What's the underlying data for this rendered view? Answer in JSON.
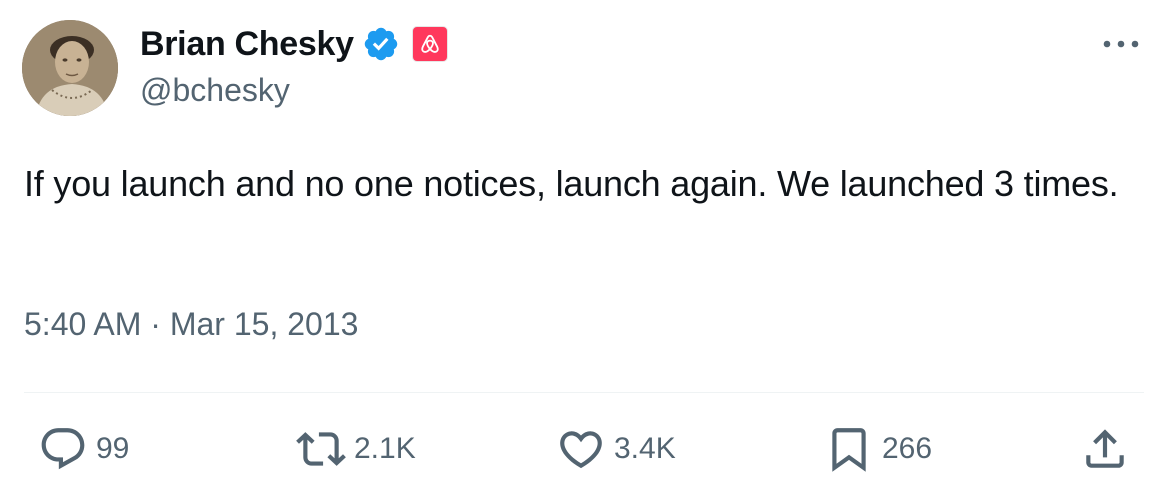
{
  "author": {
    "display_name": "Brian Chesky",
    "handle": "@bchesky",
    "verified_icon": "verified-badge-icon",
    "affiliation_icon": "airbnb-logo-icon"
  },
  "tweet": {
    "text": "If you launch and no one notices, launch again. We launched 3 times.",
    "timestamp": "5:40 AM · Mar 15, 2013"
  },
  "actions": {
    "reply": {
      "count": "99",
      "icon": "reply-icon"
    },
    "retweet": {
      "count": "2.1K",
      "icon": "retweet-icon"
    },
    "like": {
      "count": "3.4K",
      "icon": "heart-icon"
    },
    "bookmark": {
      "count": "266",
      "icon": "bookmark-icon"
    },
    "share": {
      "icon": "share-icon"
    }
  },
  "colors": {
    "text_primary": "#0f1419",
    "text_secondary": "#536471",
    "verified_blue": "#1d9bf0",
    "airbnb_red": "#ff385c",
    "divider": "#eff3f4"
  }
}
